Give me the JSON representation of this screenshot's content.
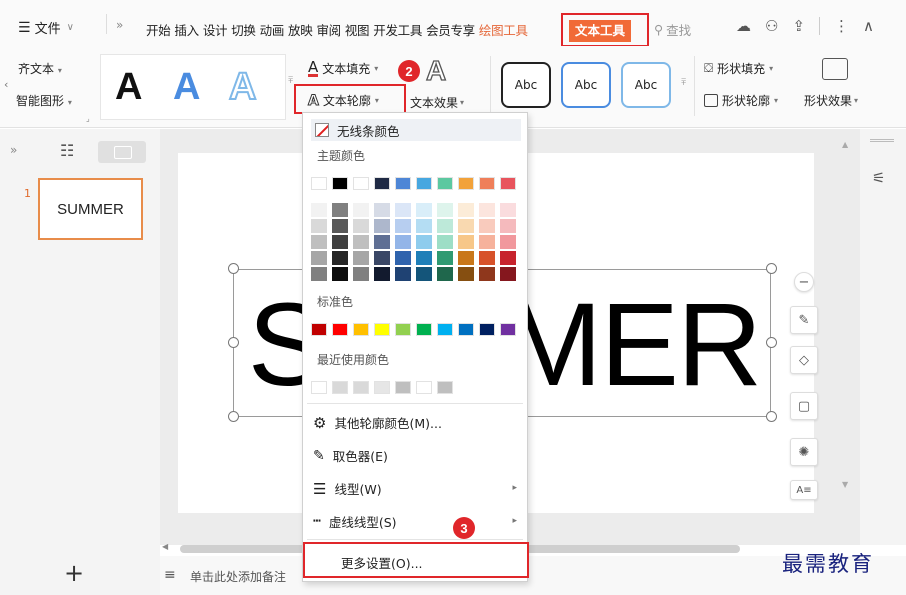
{
  "menubar": {
    "file_label": "文件",
    "tabs": [
      "开始",
      "插入",
      "设计",
      "切换",
      "动画",
      "放映",
      "审阅",
      "视图",
      "开发工具",
      "会员专享"
    ],
    "draw_tool_tab": "绘图工具",
    "text_tool_tab": "文本工具",
    "search_label": "查找"
  },
  "ribbon": {
    "left_top": "齐文本",
    "left_bottom": "智能图形",
    "text_fill": "文本填充",
    "text_outline": "文本轮廓",
    "text_effect": "文本效果",
    "style_letter": "A",
    "abc_labels": [
      "Abc",
      "Abc",
      "Abc"
    ],
    "shape_fill": "形状填充",
    "shape_outline": "形状轮廓",
    "shape_effect": "形状效果"
  },
  "slides": {
    "slide_number": "1",
    "thumbnail_text": "SUMMER"
  },
  "canvas": {
    "big_text": "SUMMER"
  },
  "dropdown": {
    "no_line_color": "无线条颜色",
    "theme_colors_title": "主题颜色",
    "theme_colors": [
      "#ffffff",
      "#000000",
      "#ffffff",
      "#1f2a44",
      "#4e86d6",
      "#47a7e0",
      "#5cc8a0",
      "#f2a23a",
      "#ef7f5a",
      "#e8545d"
    ],
    "theme_shades": [
      [
        "#f2f2f2",
        "#d9d9d9",
        "#bfbfbf",
        "#a6a6a6",
        "#808080"
      ],
      [
        "#808080",
        "#595959",
        "#404040",
        "#262626",
        "#0d0d0d"
      ],
      [
        "#f2f2f2",
        "#d9d9d9",
        "#bfbfbf",
        "#a6a6a6",
        "#808080"
      ],
      [
        "#d6dbe6",
        "#adb7cc",
        "#5f6f94",
        "#3a4766",
        "#121a2e"
      ],
      [
        "#dbe6f7",
        "#b7cef0",
        "#93b5e8",
        "#2f63ad",
        "#1f4273"
      ],
      [
        "#d9eef9",
        "#b4ddf3",
        "#8ecced",
        "#1f7fb8",
        "#14557a"
      ],
      [
        "#def4ec",
        "#bde9d9",
        "#9ddec6",
        "#2f9a72",
        "#1f674c"
      ],
      [
        "#fcecd8",
        "#f9d9b0",
        "#f7c789",
        "#c9771a",
        "#864f11"
      ],
      [
        "#fce5de",
        "#f9cbbd",
        "#f6b29c",
        "#d7522a",
        "#8f371c"
      ],
      [
        "#fadcde",
        "#f5babd",
        "#f1989d",
        "#c7232d",
        "#85171e"
      ]
    ],
    "standard_colors_title": "标准色",
    "standard_colors": [
      "#c00000",
      "#ff0000",
      "#ffc000",
      "#ffff00",
      "#92d050",
      "#00b050",
      "#00b0f0",
      "#0070c0",
      "#002060",
      "#7030a0"
    ],
    "recent_colors_title": "最近使用颜色",
    "recent_colors": [
      "#ffffff",
      "#d9d9d9",
      "#d9d9d9",
      "#e6e6e6",
      "#bfbfbf",
      "#ffffff",
      "#bfbfbf"
    ],
    "other_outline_colors": "其他轮廓颜色(M)...",
    "eyedropper": "取色器(E)",
    "line_style": "线型(W)",
    "dash_style": "虚线线型(S)",
    "more_settings": "更多设置(O)..."
  },
  "notes_placeholder": "单击此处添加备注",
  "watermark": "最需教育",
  "badges": [
    "1",
    "2",
    "3"
  ],
  "colors": {
    "accent": "#f16a37",
    "highlight_red": "#e0262a"
  }
}
